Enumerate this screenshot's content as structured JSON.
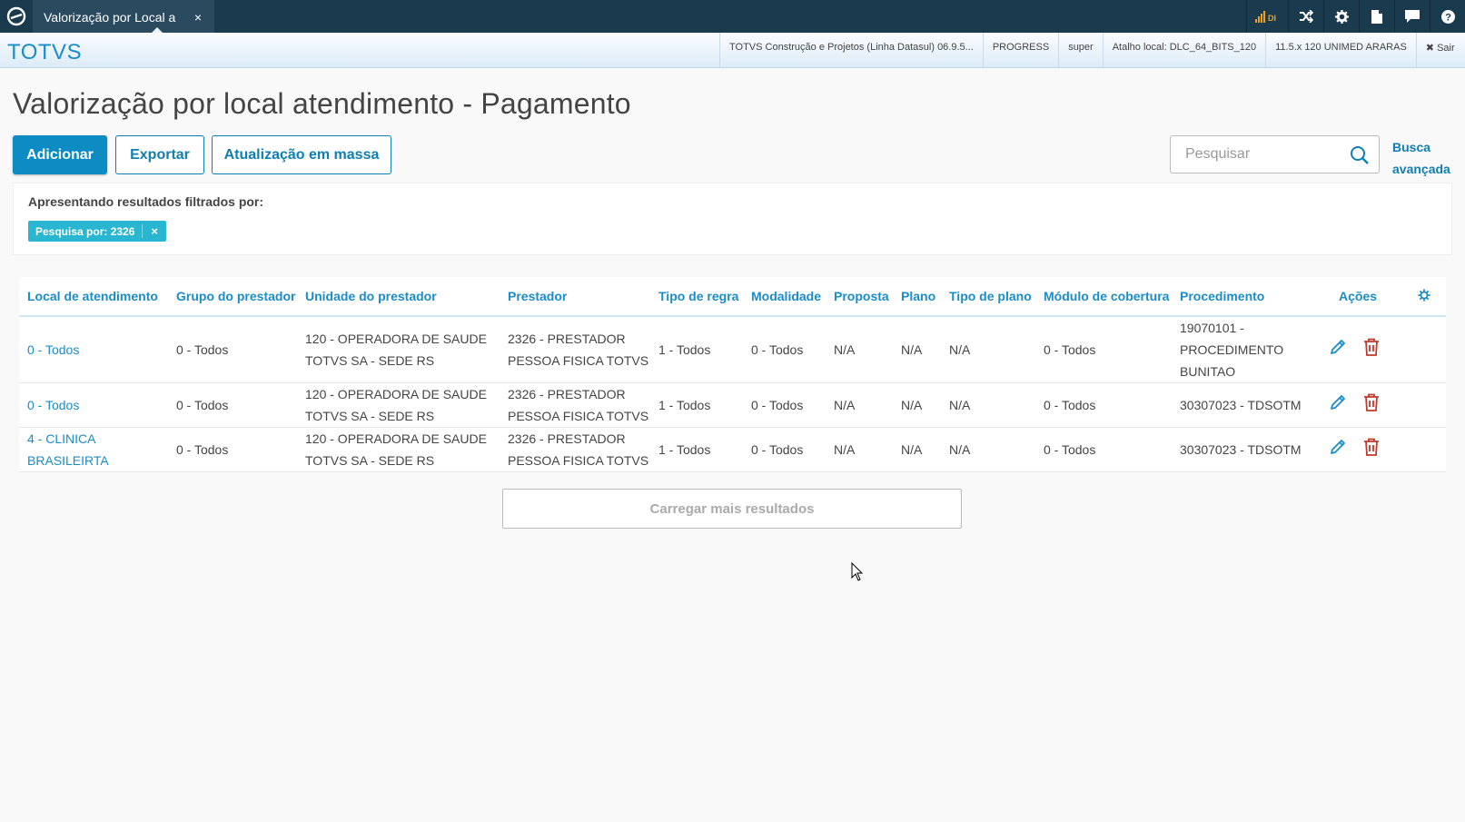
{
  "topbar": {
    "tab_label": "Valorização por Local a",
    "tab_close": "×",
    "signal_text": "DI",
    "icons": [
      "signal-icon",
      "shuffle-icon",
      "gear-icon",
      "document-icon",
      "chat-icon",
      "help-icon"
    ]
  },
  "subbar": {
    "brand": "TOTVS",
    "product": "TOTVS Construção e Projetos (Linha Datasul) 06.9.5...",
    "db": "PROGRESS",
    "user": "super",
    "shortcut": "Atalho local: DLC_64_BITS_120",
    "version": "11.5.x 120 UNIMED ARARAS",
    "logout": "✖ Sair"
  },
  "page": {
    "title": "Valorização por local atendimento - Pagamento"
  },
  "toolbar": {
    "add_label": "Adicionar",
    "export_label": "Exportar",
    "mass_update_label": "Atualização em massa"
  },
  "search": {
    "placeholder": "Pesquisar",
    "value": "",
    "advanced_line1": "Busca",
    "advanced_line2": "avançada"
  },
  "filter": {
    "title": "Apresentando resultados filtrados por:",
    "chip_label": "Pesquisa por: 2326",
    "chip_close": "×"
  },
  "table": {
    "headers": [
      "Local de atendimento",
      "Grupo do prestador",
      "Unidade do prestador",
      "Prestador",
      "Tipo de regra",
      "Modalidade",
      "Proposta",
      "Plano",
      "Tipo de plano",
      "Módulo de cobertura",
      "Procedimento",
      "Ações"
    ],
    "rows": [
      {
        "local": "0 - Todos",
        "grupo": "0 - Todos",
        "unidade": "120 - OPERADORA DE SAUDE TOTVS SA - SEDE RS",
        "prestador": "2326 - PRESTADOR PESSOA FISICA TOTVS",
        "tipo_regra": "1 - Todos",
        "modalidade": "0 - Todos",
        "proposta": "N/A",
        "plano": "N/A",
        "tipo_plano": "N/A",
        "modulo": "0 - Todos",
        "procedimento": "19070101 - PROCEDIMENTO BUNITAO"
      },
      {
        "local": "0 - Todos",
        "grupo": "0 - Todos",
        "unidade": "120 - OPERADORA DE SAUDE TOTVS SA - SEDE RS",
        "prestador": "2326 - PRESTADOR PESSOA FISICA TOTVS",
        "tipo_regra": "1 - Todos",
        "modalidade": "0 - Todos",
        "proposta": "N/A",
        "plano": "N/A",
        "tipo_plano": "N/A",
        "modulo": "0 - Todos",
        "procedimento": "30307023 - TDSOTM"
      },
      {
        "local": "4 - CLINICA BRASILEIRTA",
        "grupo": "0 - Todos",
        "unidade": "120 - OPERADORA DE SAUDE TOTVS SA - SEDE RS",
        "prestador": "2326 - PRESTADOR PESSOA FISICA TOTVS",
        "tipo_regra": "1 - Todos",
        "modalidade": "0 - Todos",
        "proposta": "N/A",
        "plano": "N/A",
        "tipo_plano": "N/A",
        "modulo": "0 - Todos",
        "procedimento": "30307023 - TDSOTM"
      }
    ]
  },
  "load_more_label": "Carregar mais resultados",
  "colors": {
    "accent": "#0d8cc4",
    "link": "#1a8cc9",
    "topbar": "#1a3a4d",
    "chip": "#29b6d0",
    "delete": "#c0392b"
  }
}
